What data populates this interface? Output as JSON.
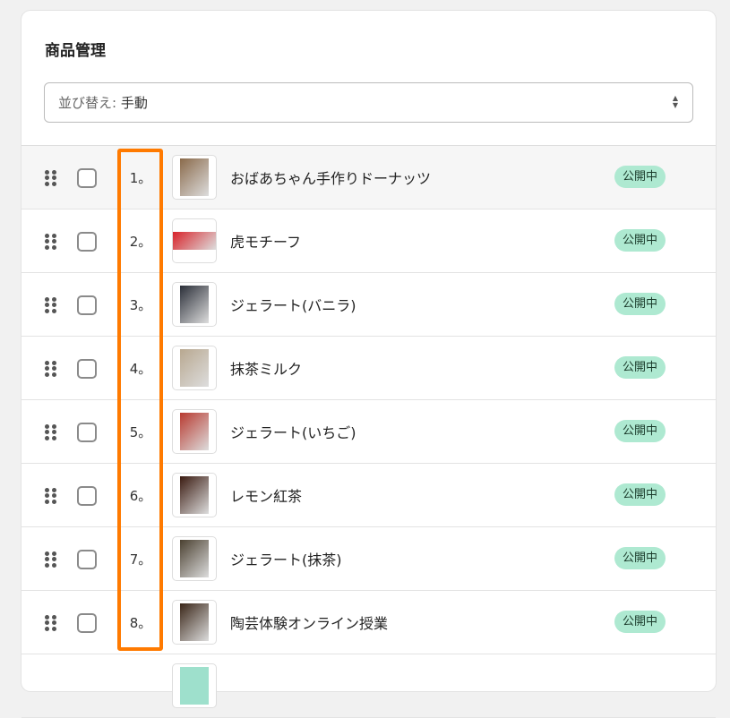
{
  "title": "商品管理",
  "sort": {
    "label": "並び替え:",
    "value": "手動"
  },
  "status_label": "公開中",
  "products": [
    {
      "num": "1。",
      "name": "おばあちゃん手作りドーナッツ",
      "thumb": "#8a6a4a"
    },
    {
      "num": "2。",
      "name": "虎モチーフ",
      "thumb": "#d8232a"
    },
    {
      "num": "3。",
      "name": "ジェラート(バニラ)",
      "thumb": "#2a2e38"
    },
    {
      "num": "4。",
      "name": "抹茶ミルク",
      "thumb": "#b8a890"
    },
    {
      "num": "5。",
      "name": "ジェラート(いちご)",
      "thumb": "#b83a30"
    },
    {
      "num": "6。",
      "name": "レモン紅茶",
      "thumb": "#3a1a10"
    },
    {
      "num": "7。",
      "name": "ジェラート(抹茶)",
      "thumb": "#4a4030"
    },
    {
      "num": "8。",
      "name": "陶芸体験オンライン授業",
      "thumb": "#3a2618"
    }
  ],
  "highlight_color": "#ff7a00"
}
